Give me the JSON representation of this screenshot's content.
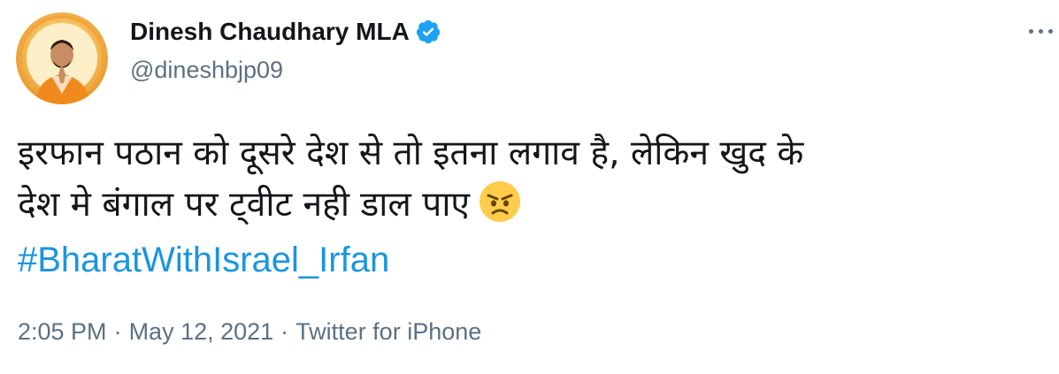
{
  "author": {
    "display_name": "Dinesh Chaudhary MLA",
    "handle": "@dineshbjp09",
    "verified": true,
    "avatar_icon": "profile-photo-namaste"
  },
  "tweet": {
    "lines": [
      "इरफान पठान को दूसरे देश से तो इतना लगाव है, लेकिन खुद के",
      "देश मे बंगाल पर ट्वीट नही डाल पाए"
    ],
    "emoji_icon": "angry-face-emoji",
    "hashtag": "#BharatWithIsrael_Irfan"
  },
  "meta": {
    "time": "2:05 PM",
    "separator": "·",
    "date": "May 12, 2021",
    "source": "Twitter for iPhone"
  },
  "colors": {
    "link": "#1b95e0",
    "secondary_text": "#5b7083",
    "verified_badge": "#1da1f2",
    "emoji_face": "#ffcc4d"
  }
}
